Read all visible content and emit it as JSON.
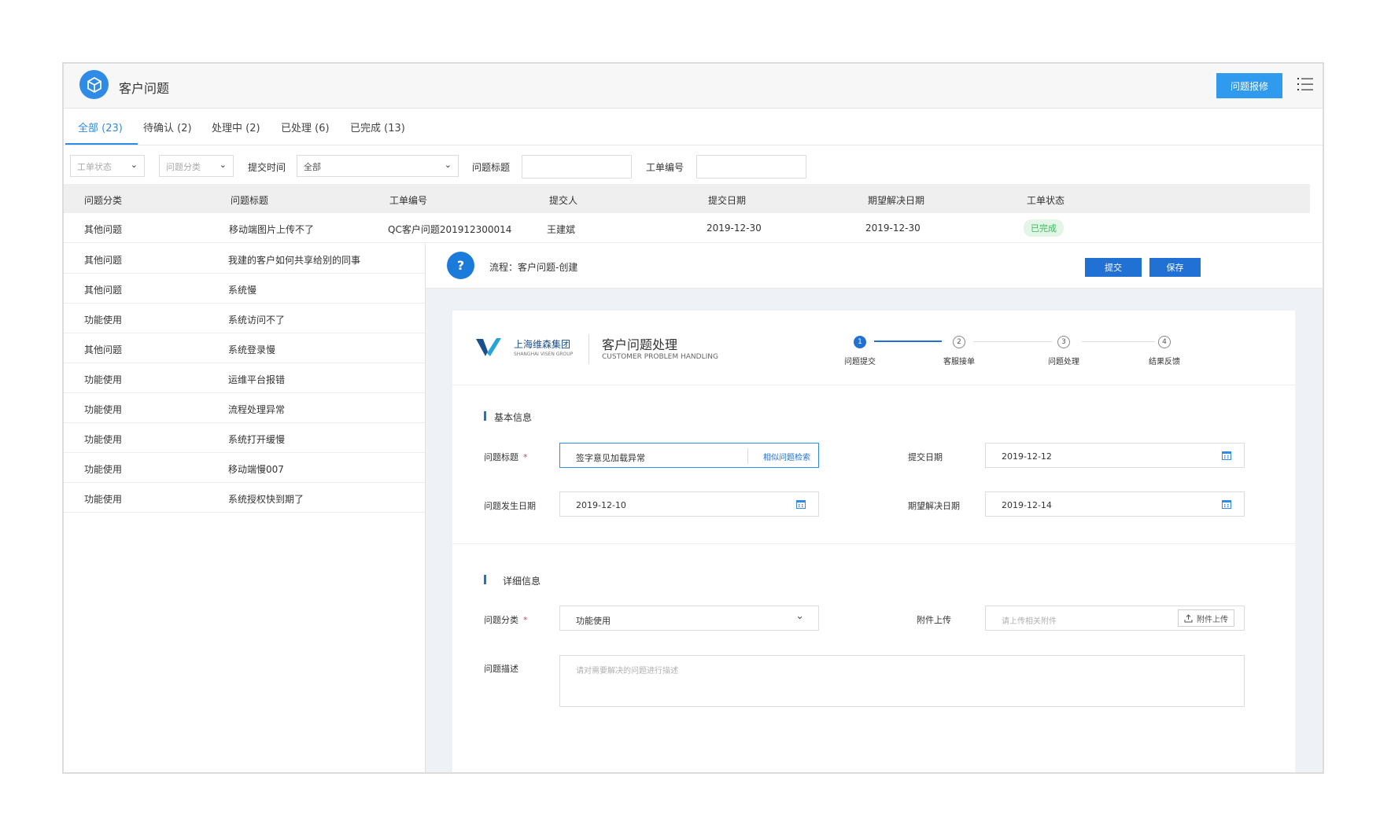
{
  "app": {
    "title": "客户问题",
    "report_button": "问题报修"
  },
  "tabs": [
    "全部 (23)",
    "待确认 (2)",
    "处理中 (2)",
    "已处理 (6)",
    "已完成 (13)"
  ],
  "filters": {
    "status_placeholder": "工单状态",
    "category_placeholder": "问题分类",
    "submit_time_label": "提交时间",
    "submit_time_value": "全部",
    "title_label": "问题标题",
    "number_label": "工单编号"
  },
  "table": {
    "headers": [
      "问题分类",
      "问题标题",
      "工单编号",
      "提交人",
      "提交日期",
      "期望解决日期",
      "工单状态"
    ],
    "first_row": {
      "category": "其他问题",
      "title": "移动端图片上传不了",
      "number": "QC客户问题201912300014",
      "submitter": "王建斌",
      "submit_date": "2019-12-30",
      "expect_date": "2019-12-30",
      "status": "已完成"
    },
    "rows": [
      {
        "category": "其他问题",
        "title": "我建的客户如何共享给别的同事"
      },
      {
        "category": "其他问题",
        "title": "系统慢"
      },
      {
        "category": "功能使用",
        "title": "系统访问不了"
      },
      {
        "category": "其他问题",
        "title": "系统登录慢"
      },
      {
        "category": "功能使用",
        "title": "运维平台报错"
      },
      {
        "category": "功能使用",
        "title": "流程处理异常"
      },
      {
        "category": "功能使用",
        "title": "系统打开缓慢"
      },
      {
        "category": "功能使用",
        "title": "移动端慢007"
      },
      {
        "category": "功能使用",
        "title": "系统授权快到期了"
      }
    ]
  },
  "panel": {
    "flow_label": "流程：客户问题-创建",
    "submit_button": "提交",
    "save_button": "保存",
    "brand_cn": "上海维森集团",
    "brand_en": "SHANGHAI VISEN GROUP",
    "form_title": "客户问题处理",
    "form_subtitle": "CUSTOMER PROBLEM HANDLING",
    "steps": [
      {
        "num": "1",
        "label": "问题提交"
      },
      {
        "num": "2",
        "label": "客服接单"
      },
      {
        "num": "3",
        "label": "问题处理"
      },
      {
        "num": "4",
        "label": "结果反馈"
      }
    ],
    "basic_section": "基本信息",
    "detail_section": "详细信息",
    "fields": {
      "title_label": "问题标题",
      "title_value": "签字意见加载异常",
      "similar_search": "相似问题检索",
      "submit_date_label": "提交日期",
      "submit_date_value": "2019-12-12",
      "occur_date_label": "问题发生日期",
      "occur_date_value": "2019-12-10",
      "expect_date_label": "期望解决日期",
      "expect_date_value": "2019-12-14",
      "category_label": "问题分类",
      "category_value": "功能使用",
      "attachment_label": "附件上传",
      "attachment_placeholder": "请上传相关附件",
      "attachment_button": "附件上传",
      "desc_label": "问题描述",
      "desc_placeholder": "请对需要解决的问题进行描述",
      "required_mark": "*"
    }
  },
  "colors": {
    "accent": "#2f8be6",
    "primary": "#2170d4",
    "success_bg": "#e2f5e6",
    "success_text": "#3cb85a",
    "required": "#e63e3e"
  }
}
